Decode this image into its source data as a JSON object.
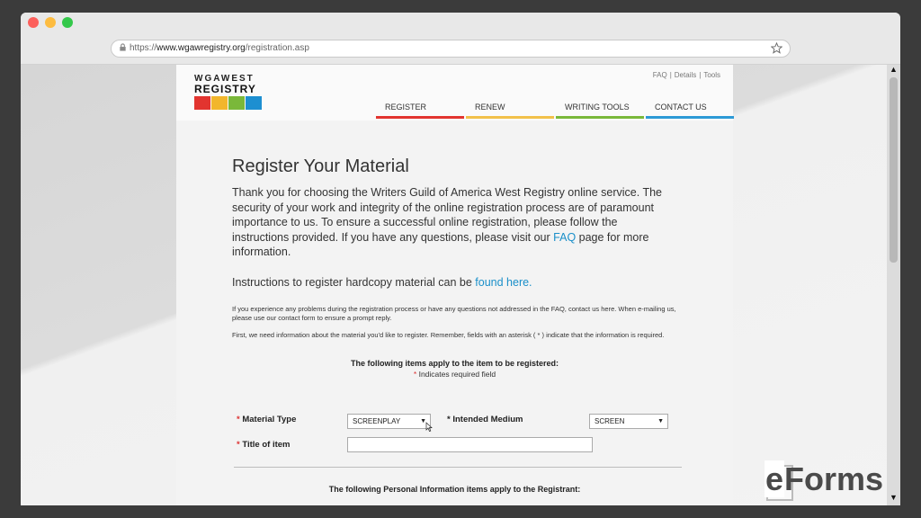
{
  "browser": {
    "url_scheme": "https://",
    "url_host": "www.wgawregistry.org",
    "url_path": "/registration.asp"
  },
  "header": {
    "logo_line1": "WGAWEST",
    "logo_line2": "REGISTRY",
    "logo_tile_colors": [
      "#e2342f",
      "#f2b62c",
      "#7ab83a",
      "#1d8fd1"
    ],
    "util_links": [
      "FAQ",
      "Details",
      "Tools"
    ],
    "nav": [
      {
        "label": "REGISTER",
        "color": "#e2342f"
      },
      {
        "label": "RENEW",
        "color": "#f2c14a"
      },
      {
        "label": "WRITING TOOLS",
        "color": "#7ab83a"
      },
      {
        "label": "CONTACT US",
        "color": "#2d9ad6"
      }
    ]
  },
  "main": {
    "title": "Register Your Material",
    "intro_before_link": "Thank you for choosing the Writers Guild of America West Registry online service. The security of your work and integrity of the online registration process are of paramount importance to us. To ensure a successful online registration, please follow the instructions provided. If you have any questions, please visit our ",
    "intro_link": "FAQ",
    "intro_after_link": " page for more information.",
    "hardcopy_text": "Instructions to register hardcopy material can be ",
    "hardcopy_link": "found here.",
    "problems_text": "If you experience any problems during the registration process or have any questions not addressed in the FAQ, contact us here. When e-mailing us, please use our contact form to ensure a prompt reply.",
    "first_text": "First, we need information about the material you'd like to register. Remember, fields with an asterisk ( * ) indicate that the information is required.",
    "items_title": "The following items apply to the item to be registered:",
    "required_note": "Indicates required field",
    "personal_title": "The following Personal Information items apply to the Registrant:"
  },
  "form": {
    "material_type_label": "Material Type",
    "material_type_value": "SCREENPLAY",
    "intended_medium_label": "Intended Medium",
    "intended_medium_value": "SCREEN",
    "title_label": "Title of item",
    "title_value": ""
  },
  "watermark": {
    "e": "e",
    "rest": "Forms"
  }
}
